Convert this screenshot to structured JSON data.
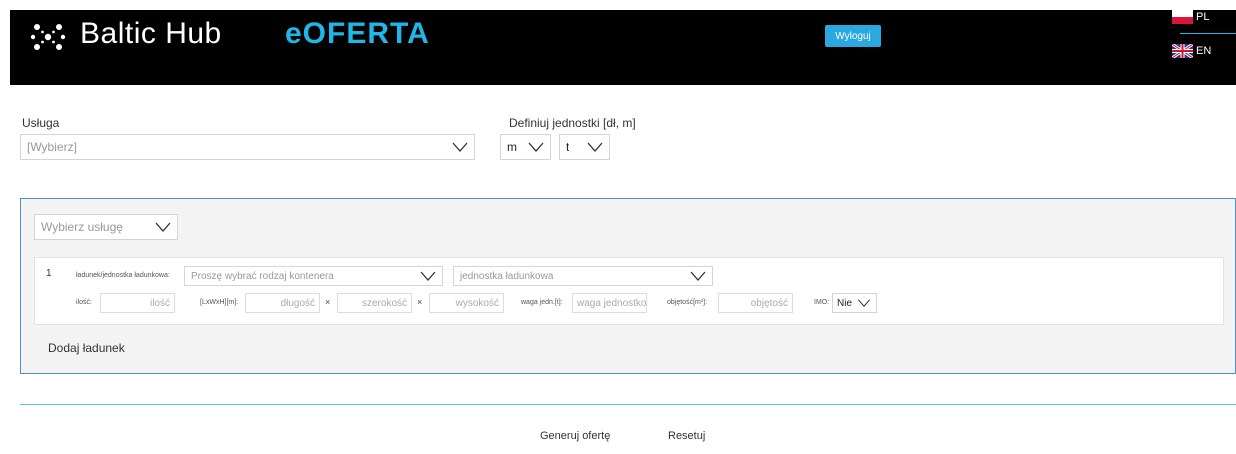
{
  "header": {
    "brand": "Baltic Hub",
    "product": "eOFERTA",
    "logout_label": "Wyloguj",
    "languages": [
      {
        "code": "PL",
        "icon": "poland-flag-icon"
      },
      {
        "code": "EN",
        "icon": "uk-flag-icon"
      }
    ],
    "colors": {
      "background": "#000000",
      "accent": "#1fb6e8",
      "button": "#29a9e0"
    }
  },
  "service": {
    "label": "Usługa",
    "placeholder": "[Wybierz]"
  },
  "units": {
    "label": "Definiuj jednostki [dł, m]",
    "length": "m",
    "weight": "t"
  },
  "panel": {
    "service_select_placeholder": "Wybierz usługę",
    "cargo_rows": [
      {
        "index": "1",
        "cargo_unit_label": "ładunek/jednostka ładunkowa:",
        "container_placeholder": "Proszę wybrać rodzaj kontenera",
        "unit_placeholder": "jednostka ładunkowa",
        "quantity_label": "ilość:",
        "quantity_placeholder": "ilość",
        "dims_label": "[LxWxH][m]:",
        "length_placeholder": "długość",
        "width_placeholder": "szerokość",
        "height_placeholder": "wysokość",
        "times_symbol": "×",
        "weight_label": "waga jedn.[t]:",
        "weight_placeholder": "waga jednostkow",
        "volume_label": "objętość[m³]:",
        "volume_placeholder": "objętość",
        "imo_label": "IMO:",
        "imo_value": "Nie"
      }
    ],
    "add_cargo_label": "Dodaj ładunek"
  },
  "actions": {
    "generate_label": "Generuj ofertę",
    "reset_label": "Resetuj"
  }
}
